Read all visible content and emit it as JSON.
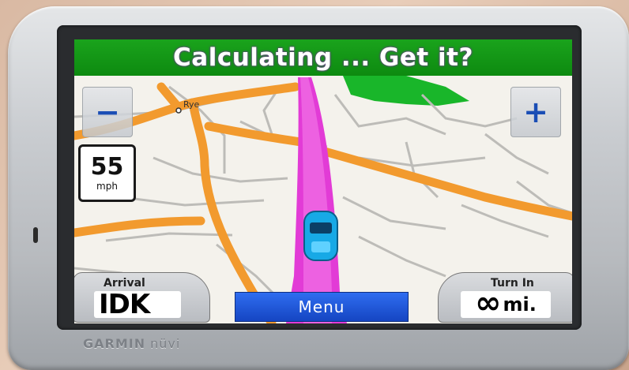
{
  "banner": {
    "text": "Calculating ... Get it?"
  },
  "map": {
    "town_label": "Rye"
  },
  "zoom": {
    "minus_glyph": "−",
    "plus_glyph": "+"
  },
  "speed_limit": {
    "value": "55",
    "unit": "mph"
  },
  "arrival": {
    "label": "Arrival",
    "value": "IDK"
  },
  "turn": {
    "label": "Turn In",
    "value": "∞",
    "unit": "mi."
  },
  "menu": {
    "label": "Menu"
  },
  "device": {
    "brand": "GARMIN",
    "model": "nüvi"
  },
  "colors": {
    "banner_green": "#12991a",
    "route_magenta": "#e23bd6",
    "road_orange": "#f29a2e",
    "menu_blue": "#1e55d6",
    "map_background": "#f4f2ec"
  }
}
